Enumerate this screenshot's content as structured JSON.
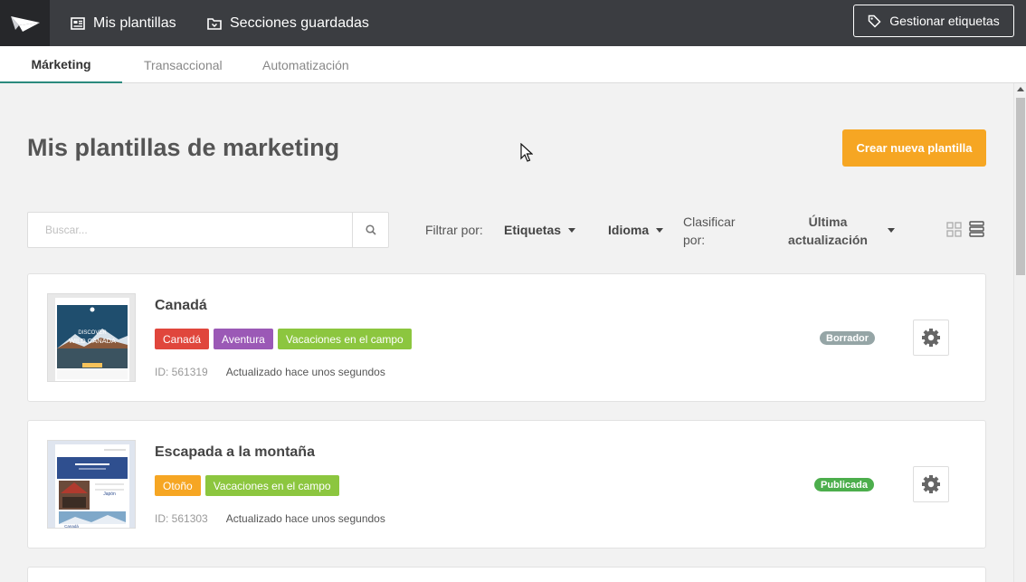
{
  "topbar": {
    "logo": "paper-plane-logo",
    "nav": [
      {
        "label": "Mis plantillas",
        "icon": "template-icon"
      },
      {
        "label": "Secciones guardadas",
        "icon": "folder-save-icon"
      }
    ],
    "manage_tags_label": "Gestionar etiquetas",
    "manage_tags_icon": "tag-icon"
  },
  "tabs": [
    {
      "label": "Márketing",
      "active": true
    },
    {
      "label": "Transaccional",
      "active": false
    },
    {
      "label": "Automatización",
      "active": false
    }
  ],
  "main": {
    "title": "Mis plantillas de marketing",
    "create_button": "Crear nueva plantilla"
  },
  "toolbar": {
    "search_placeholder": "Buscar...",
    "search_value": "",
    "filter_label": "Filtrar por:",
    "filter_tags": "Etiquetas",
    "filter_language": "Idioma",
    "sort_label": "Clasificar por:",
    "sort_value": "Última actualización",
    "views": [
      "grid-view-icon",
      "list-view-icon"
    ]
  },
  "colors": {
    "accent": "#f6a623",
    "tab_underline": "#2b8a7e",
    "topbar": "#3b3d41"
  },
  "templates": [
    {
      "name": "Canadá",
      "thumb_text": [
        "DISCOVER",
        "WILD CANADA"
      ],
      "tags": [
        {
          "label": "Canadá",
          "color": "#e0463c"
        },
        {
          "label": "Aventura",
          "color": "#9b59b6"
        },
        {
          "label": "Vacaciones en el campo",
          "color": "#8cc63f"
        }
      ],
      "id": "ID: 561319",
      "updated": "Actualizado hace unos segundos",
      "status": "Borrador",
      "status_color": "#95a5a6"
    },
    {
      "name": "Escapada a la montaña",
      "thumb_text": [
        "Japón",
        "Canadá"
      ],
      "tags": [
        {
          "label": "Otoño",
          "color": "#f6a623"
        },
        {
          "label": "Vacaciones en el campo",
          "color": "#8cc63f"
        }
      ],
      "id": "ID: 561303",
      "updated": "Actualizado hace unos segundos",
      "status": "Publicada",
      "status_color": "#4cae4c"
    }
  ]
}
